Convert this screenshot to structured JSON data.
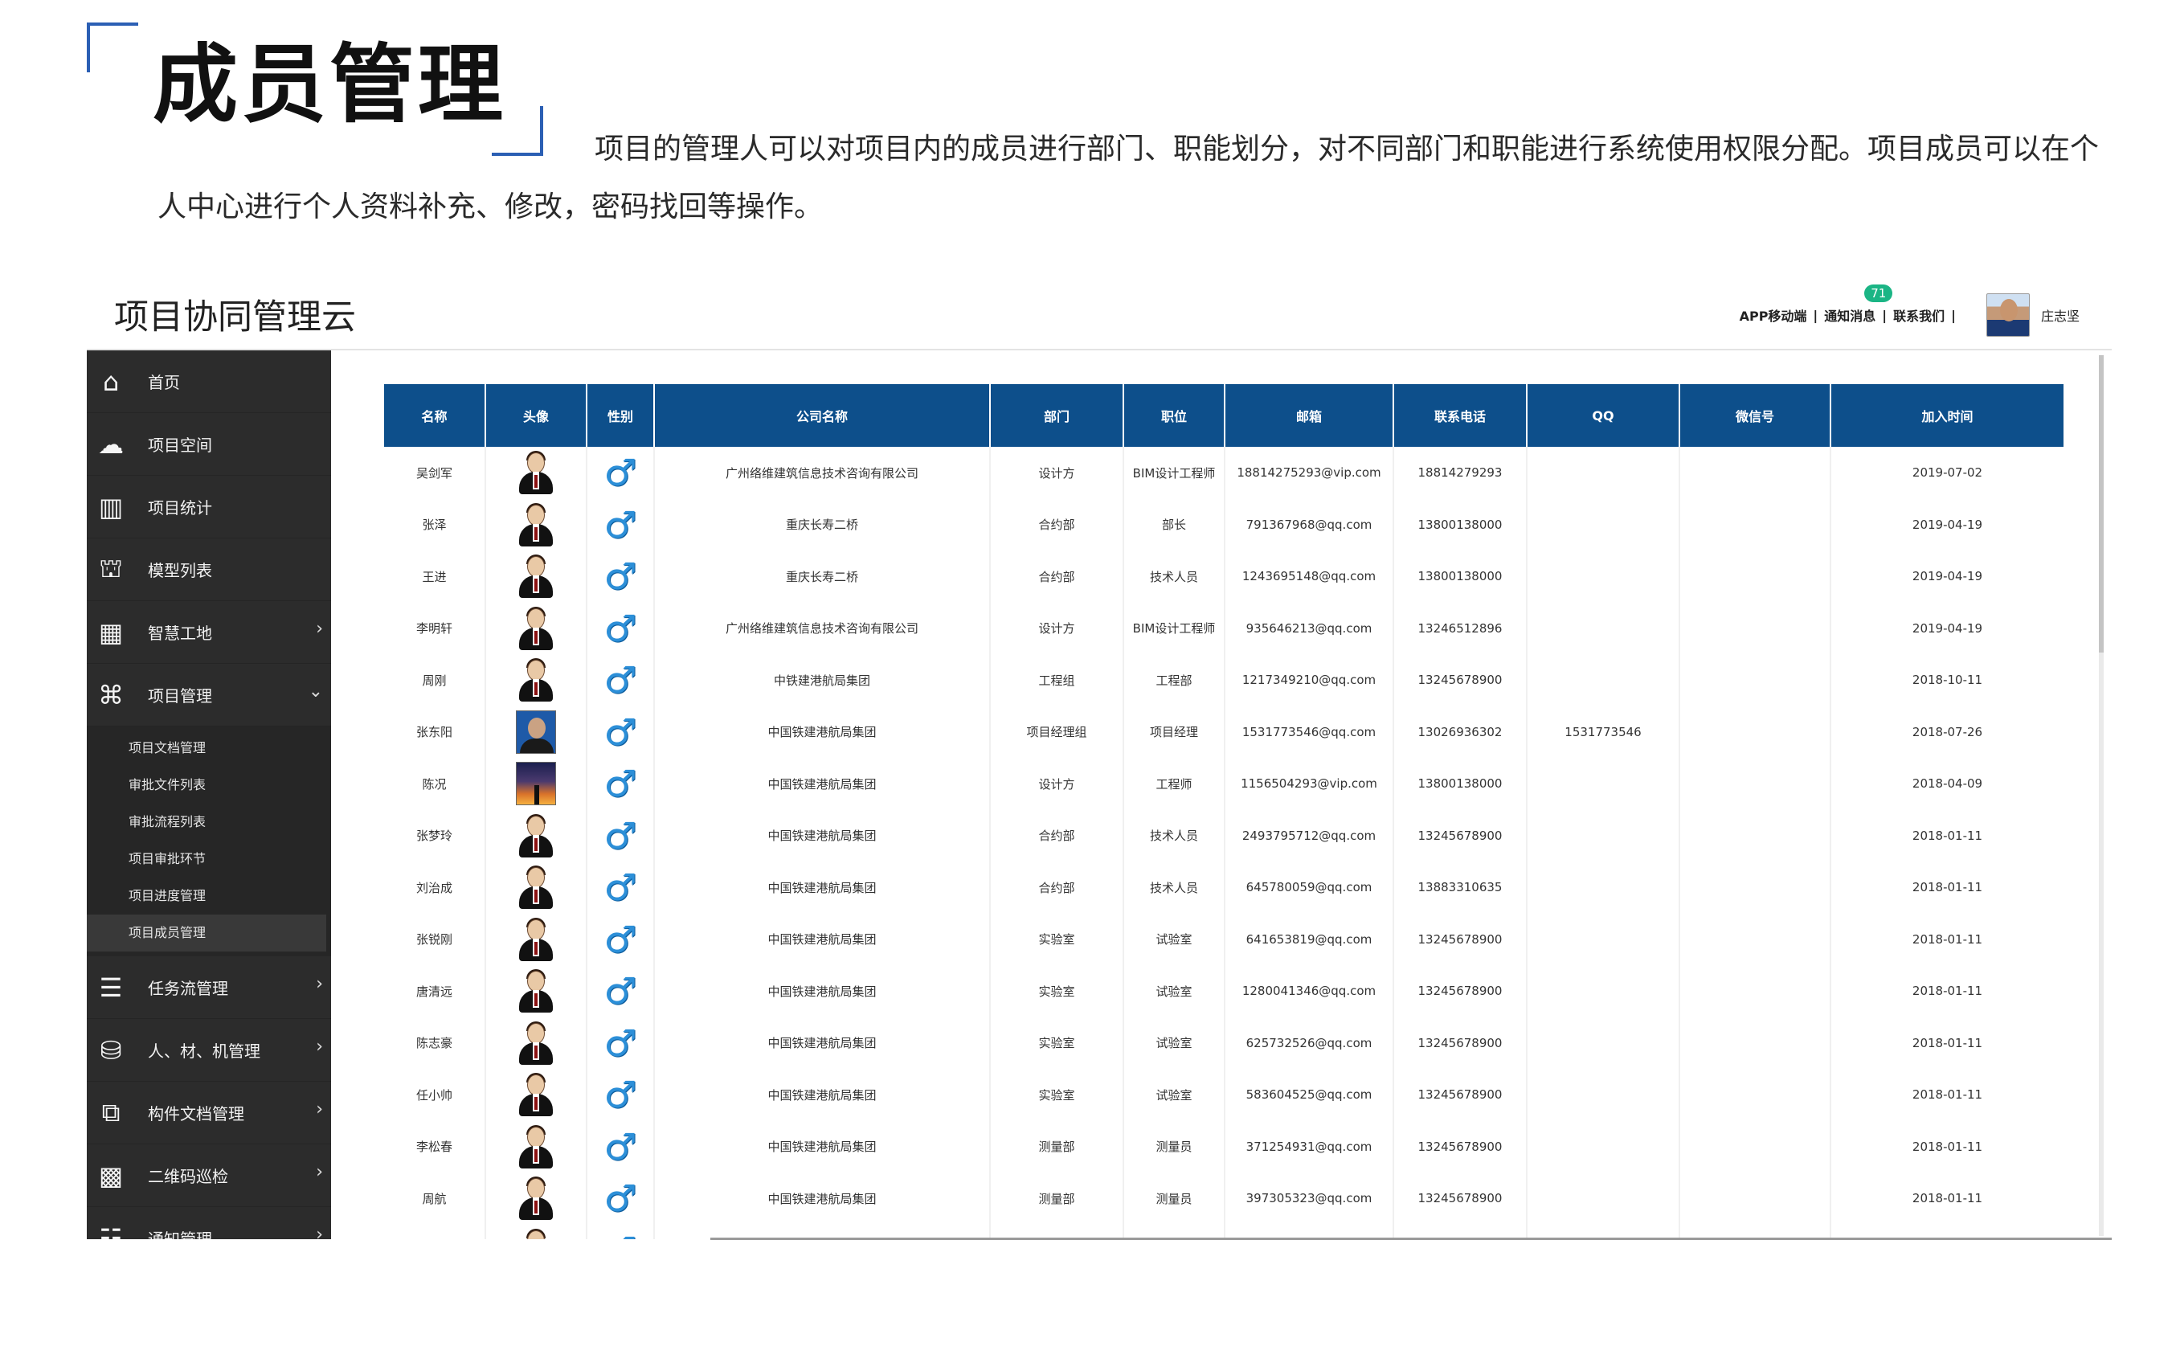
{
  "intro": {
    "title": "成员管理",
    "description": "项目的管理人可以对项目内的成员进行部门、职能划分，对不同部门和职能进行系统使用权限分配。项目成员可以在个人中心进行个人资料补充、修改，密码找回等操作。"
  },
  "app": {
    "title": "项目协同管理云",
    "topbar": {
      "app_link": "APP移动端",
      "notify_link": "通知消息",
      "notify_count": "71",
      "contact_link": "联系我们",
      "separator": "|",
      "user_name": "庄志坚"
    },
    "colors": {
      "sidebar_bg": "#2c2c2c",
      "table_header": "#0d4f8b",
      "badge": "#1bb585",
      "accent": "#2b5fb4"
    },
    "sidebar": {
      "items": [
        {
          "label": "首页",
          "icon": "home-icon",
          "glyph": "⌂"
        },
        {
          "label": "项目空间",
          "icon": "cloud-icon",
          "glyph": "☁"
        },
        {
          "label": "项目统计",
          "icon": "bar-chart-icon",
          "glyph": "▥"
        },
        {
          "label": "模型列表",
          "icon": "bank-icon",
          "glyph": "⛫"
        },
        {
          "label": "智慧工地",
          "icon": "building-icon",
          "glyph": "▦",
          "arrow": "›"
        },
        {
          "label": "项目管理",
          "icon": "sitemap-icon",
          "glyph": "⌘",
          "arrow": "⌄"
        }
      ],
      "sub_items": [
        "项目文档管理",
        "审批文件列表",
        "审批流程列表",
        "项目审批环节",
        "项目进度管理",
        "项目成员管理"
      ],
      "items_after": [
        {
          "label": "任务流管理",
          "icon": "server-icon",
          "glyph": "☰",
          "arrow": "›"
        },
        {
          "label": "人、材、机管理",
          "icon": "cubes-icon",
          "glyph": "⛁",
          "arrow": "›"
        },
        {
          "label": "构件文档管理",
          "icon": "copy-icon",
          "glyph": "⧉",
          "arrow": "›"
        },
        {
          "label": "二维码巡检",
          "icon": "qrcode-icon",
          "glyph": "▩",
          "arrow": "›"
        },
        {
          "label": "通知管理",
          "icon": "list-icon",
          "glyph": "☷",
          "arrow": "›"
        }
      ]
    },
    "table": {
      "columns": [
        "名称",
        "头像",
        "性别",
        "公司名称",
        "部门",
        "职位",
        "邮箱",
        "联系电话",
        "QQ",
        "微信号",
        "加入时间"
      ],
      "rows": [
        {
          "name": "吴剑军",
          "avatar": "default",
          "gender": "♂",
          "company": "广州络维建筑信息技术咨询有限公司",
          "dept": "设计方",
          "position": "BIM设计工程师",
          "email": "18814275293@vip.com",
          "phone": "18814279293",
          "qq": "",
          "wechat": "",
          "joined": "2019-07-02"
        },
        {
          "name": "张泽",
          "avatar": "default",
          "gender": "♂",
          "company": "重庆长寿二桥",
          "dept": "合约部",
          "position": "部长",
          "email": "791367968@qq.com",
          "phone": "13800138000",
          "qq": "",
          "wechat": "",
          "joined": "2019-04-19"
        },
        {
          "name": "王进",
          "avatar": "default",
          "gender": "♂",
          "company": "重庆长寿二桥",
          "dept": "合约部",
          "position": "技术人员",
          "email": "1243695148@qq.com",
          "phone": "13800138000",
          "qq": "",
          "wechat": "",
          "joined": "2019-04-19"
        },
        {
          "name": "李明轩",
          "avatar": "default",
          "gender": "♂",
          "company": "广州络维建筑信息技术咨询有限公司",
          "dept": "设计方",
          "position": "BIM设计工程师",
          "email": "935646213@qq.com",
          "phone": "13246512896",
          "qq": "",
          "wechat": "",
          "joined": "2019-04-19"
        },
        {
          "name": "周刚",
          "avatar": "default",
          "gender": "♂",
          "company": "中铁建港航局集团",
          "dept": "工程组",
          "position": "工程部",
          "email": "1217349210@qq.com",
          "phone": "13245678900",
          "qq": "",
          "wechat": "",
          "joined": "2018-10-11"
        },
        {
          "name": "张东阳",
          "avatar": "photo1",
          "gender": "♂",
          "company": "中国铁建港航局集团",
          "dept": "项目经理组",
          "position": "项目经理",
          "email": "1531773546@qq.com",
          "phone": "13026936302",
          "qq": "1531773546",
          "wechat": "",
          "joined": "2018-07-26"
        },
        {
          "name": "陈况",
          "avatar": "photo2",
          "gender": "♂",
          "company": "中国铁建港航局集团",
          "dept": "设计方",
          "position": "工程师",
          "email": "1156504293@vip.com",
          "phone": "13800138000",
          "qq": "",
          "wechat": "",
          "joined": "2018-04-09"
        },
        {
          "name": "张梦玲",
          "avatar": "default",
          "gender": "♂",
          "company": "中国铁建港航局集团",
          "dept": "合约部",
          "position": "技术人员",
          "email": "2493795712@qq.com",
          "phone": "13245678900",
          "qq": "",
          "wechat": "",
          "joined": "2018-01-11"
        },
        {
          "name": "刘治成",
          "avatar": "default",
          "gender": "♂",
          "company": "中国铁建港航局集团",
          "dept": "合约部",
          "position": "技术人员",
          "email": "645780059@qq.com",
          "phone": "13883310635",
          "qq": "",
          "wechat": "",
          "joined": "2018-01-11"
        },
        {
          "name": "张锐刚",
          "avatar": "default",
          "gender": "♂",
          "company": "中国铁建港航局集团",
          "dept": "实验室",
          "position": "试验室",
          "email": "641653819@qq.com",
          "phone": "13245678900",
          "qq": "",
          "wechat": "",
          "joined": "2018-01-11"
        },
        {
          "name": "唐清远",
          "avatar": "default",
          "gender": "♂",
          "company": "中国铁建港航局集团",
          "dept": "实验室",
          "position": "试验室",
          "email": "1280041346@qq.com",
          "phone": "13245678900",
          "qq": "",
          "wechat": "",
          "joined": "2018-01-11"
        },
        {
          "name": "陈志豪",
          "avatar": "default",
          "gender": "♂",
          "company": "中国铁建港航局集团",
          "dept": "实验室",
          "position": "试验室",
          "email": "625732526@qq.com",
          "phone": "13245678900",
          "qq": "",
          "wechat": "",
          "joined": "2018-01-11"
        },
        {
          "name": "任小帅",
          "avatar": "default",
          "gender": "♂",
          "company": "中国铁建港航局集团",
          "dept": "实验室",
          "position": "试验室",
          "email": "583604525@qq.com",
          "phone": "13245678900",
          "qq": "",
          "wechat": "",
          "joined": "2018-01-11"
        },
        {
          "name": "李松春",
          "avatar": "default",
          "gender": "♂",
          "company": "中国铁建港航局集团",
          "dept": "测量部",
          "position": "测量员",
          "email": "371254931@qq.com",
          "phone": "13245678900",
          "qq": "",
          "wechat": "",
          "joined": "2018-01-11"
        },
        {
          "name": "周航",
          "avatar": "default",
          "gender": "♂",
          "company": "中国铁建港航局集团",
          "dept": "测量部",
          "position": "测量员",
          "email": "397305323@qq.com",
          "phone": "13245678900",
          "qq": "",
          "wechat": "",
          "joined": "2018-01-11"
        },
        {
          "name": "",
          "avatar": "default",
          "gender": "♂",
          "company": "",
          "dept": "",
          "position": "",
          "email": "",
          "phone": "",
          "qq": "",
          "wechat": "",
          "joined": ""
        }
      ]
    }
  }
}
